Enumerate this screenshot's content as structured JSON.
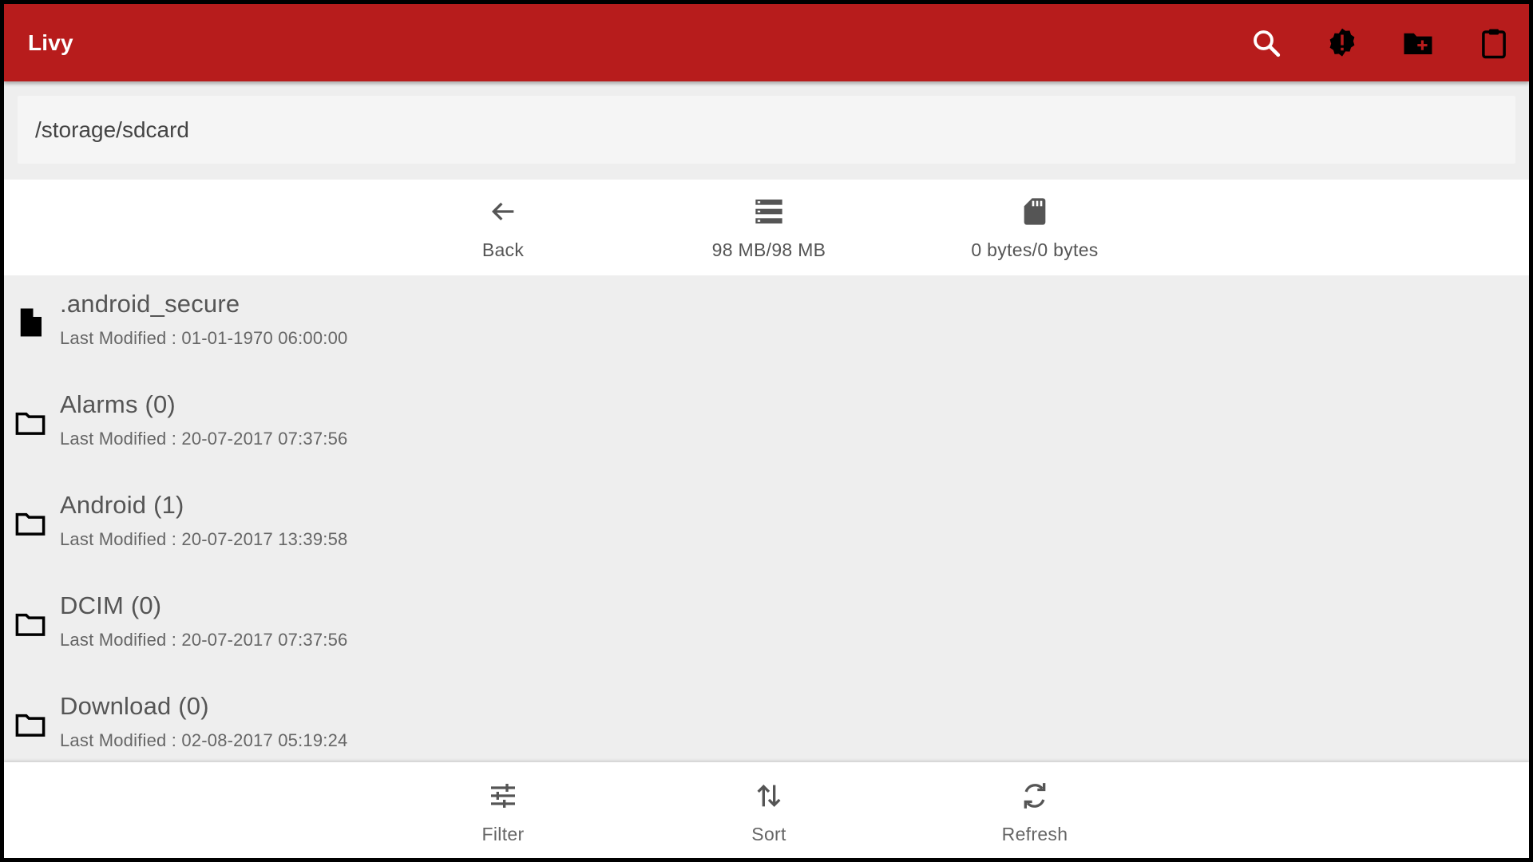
{
  "app": {
    "title": "Livy",
    "accent_color": "#b71c1c",
    "actions": [
      {
        "name": "search-icon",
        "label": "Search"
      },
      {
        "name": "alert-badge-icon",
        "label": "Alert"
      },
      {
        "name": "create-folder-icon",
        "label": "New folder"
      },
      {
        "name": "clipboard-icon",
        "label": "Clipboard"
      }
    ]
  },
  "path": {
    "current": "/storage/sdcard"
  },
  "toolbar": {
    "back": {
      "label": "Back",
      "icon": "arrow-left-icon"
    },
    "internal_storage": {
      "label": "98 MB/98 MB",
      "icon": "storage-list-icon"
    },
    "sd_card": {
      "label": "0 bytes/0 bytes",
      "icon": "sd-card-icon"
    }
  },
  "files": [
    {
      "name": ".android_secure",
      "modified": "Last Modified : 01-01-1970 06:00:00",
      "type": "file"
    },
    {
      "name": "Alarms (0)",
      "modified": "Last Modified : 20-07-2017 07:37:56",
      "type": "folder"
    },
    {
      "name": "Android (1)",
      "modified": "Last Modified : 20-07-2017 13:39:58",
      "type": "folder"
    },
    {
      "name": "DCIM (0)",
      "modified": "Last Modified : 20-07-2017 07:37:56",
      "type": "folder"
    },
    {
      "name": "Download (0)",
      "modified": "Last Modified : 02-08-2017 05:19:24",
      "type": "folder"
    }
  ],
  "bottom_bar": {
    "filter": {
      "label": "Filter",
      "icon": "filter-sliders-icon"
    },
    "sort": {
      "label": "Sort",
      "icon": "sort-arrows-icon"
    },
    "refresh": {
      "label": "Refresh",
      "icon": "refresh-icon"
    }
  }
}
